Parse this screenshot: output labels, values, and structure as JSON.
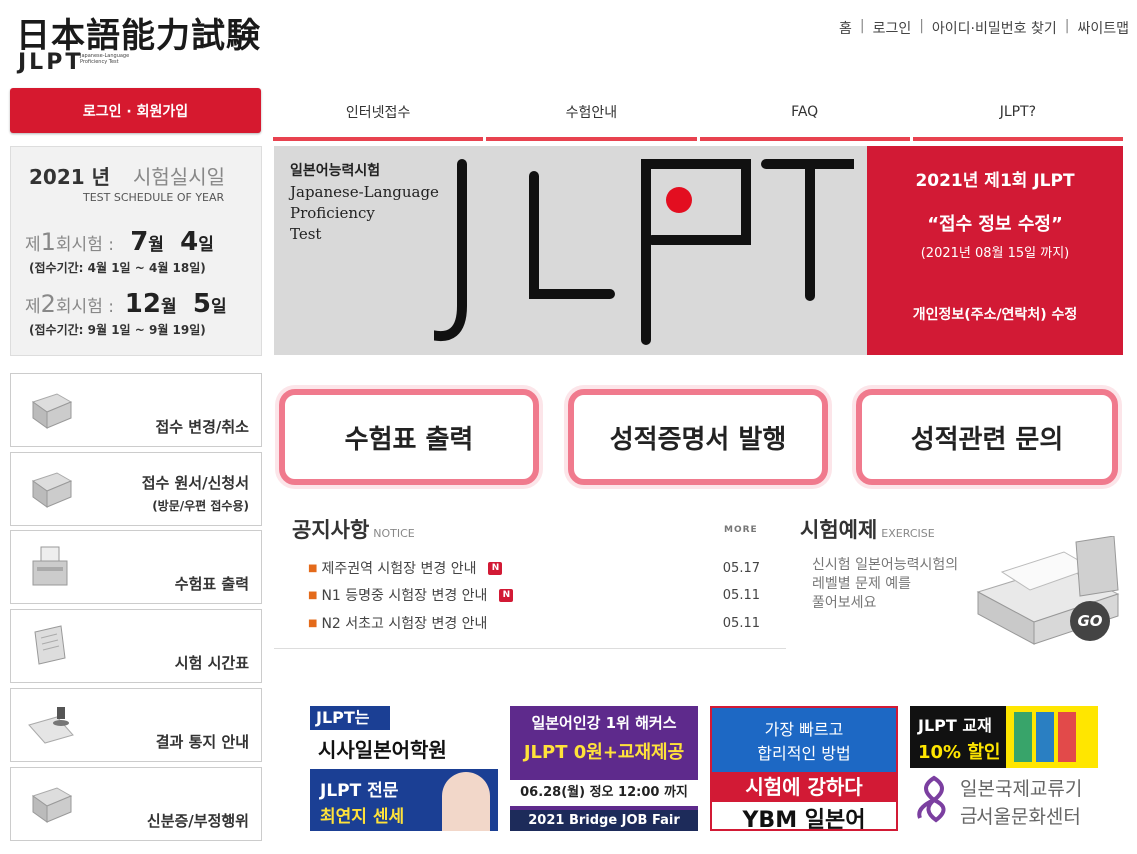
{
  "header": {
    "logo_kanji": "日本語能力試験",
    "logo_jlpt": "JLPT",
    "logo_sub": "Japanese-Language Proficiency Test",
    "top_links": [
      "홈",
      "로그인",
      "아이디·비밀번호 찾기",
      "싸이트맵"
    ]
  },
  "login_button": "로그인 · 회원가입",
  "nav": [
    "인터넷접수",
    "수험안내",
    "FAQ",
    "JLPT?"
  ],
  "schedule": {
    "year": "2021 년",
    "label": "시험실시일",
    "sub": "TEST SCHEDULE OF YEAR",
    "exams": [
      {
        "prefix": "제",
        "num": "1",
        "suffix": "회시험 :",
        "month": "7",
        "month_unit": "월",
        "day": "4",
        "day_unit": "일",
        "period": "(접수기간: 4월 1일 ~ 4월 18일)"
      },
      {
        "prefix": "제",
        "num": "2",
        "suffix": "회시험 :",
        "month": "12",
        "month_unit": "월",
        "day": "5",
        "day_unit": "일",
        "period": "(접수기간: 9월 1일 ~ 9월 19일)"
      }
    ]
  },
  "left_menu": [
    {
      "label": "접수 변경/취소",
      "sub": "",
      "icon": "cabinet-icon"
    },
    {
      "label": "접수 원서/신청서",
      "sub": "(방문/우편 접수용)",
      "icon": "cabinet-icon"
    },
    {
      "label": "수험표 출력",
      "sub": "",
      "icon": "printer-icon"
    },
    {
      "label": "시험 시간표",
      "sub": "",
      "icon": "calendar-icon"
    },
    {
      "label": "결과 통지 안내",
      "sub": "",
      "icon": "stamp-icon"
    },
    {
      "label": "신분증/부정행위",
      "sub": "",
      "icon": "cabinet-icon"
    }
  ],
  "banner": {
    "kr": "일본어능력시험",
    "en": [
      "Japanese-Language",
      "Proficiency",
      "Test"
    ],
    "big": "JLPT",
    "red": {
      "t1": "2021년 제1회 JLPT",
      "t2": "“접수 정보 수정”",
      "t3": "(2021년 08월 15일 까지)",
      "t4": "개인정보(주소/연락처) 수정"
    }
  },
  "quick_buttons": [
    "수험표 출력",
    "성적증명서 발행",
    "성적관련 문의"
  ],
  "notice": {
    "title": "공지사항",
    "title_en": "NOTICE",
    "more": "MORE",
    "items": [
      {
        "text": "제주권역 시험장 변경 안내",
        "new": "N",
        "date": "05.17"
      },
      {
        "text": "N1 등명중 시험장 변경 안내",
        "new": "N",
        "date": "05.11"
      },
      {
        "text": "N2 서초고 시험장 변경 안내",
        "new": "",
        "date": "05.11"
      }
    ]
  },
  "exercise": {
    "title": "시험예제",
    "title_en": "EXERCISE",
    "lines": [
      "신시험 일본어능력시험의",
      "레벨별 문제 예를",
      "풀어보세요"
    ],
    "go": "GO"
  },
  "ads": {
    "a1": {
      "l1": "JLPT는",
      "l2": "시사일본어학원",
      "l3": "JLPT 전문",
      "l4": "최연지 센세"
    },
    "a2": {
      "l1": "일본어인강 1위 해커스",
      "l2": "JLPT 0원+교재제공",
      "l3": "06.28(월) 정오 12:00 까지",
      "l4": "2021 Bridge JOB Fair"
    },
    "a3": {
      "l1": "가장 빠르고",
      "l2": "합리적인 방법",
      "l3": "시험에 강하다",
      "l4": "YBM 일본어"
    },
    "a4": {
      "l1": "JLPT 교재",
      "l2": "10% 할인",
      "l3": "일본국제교류기금",
      "l4": "서울문화센터"
    }
  }
}
